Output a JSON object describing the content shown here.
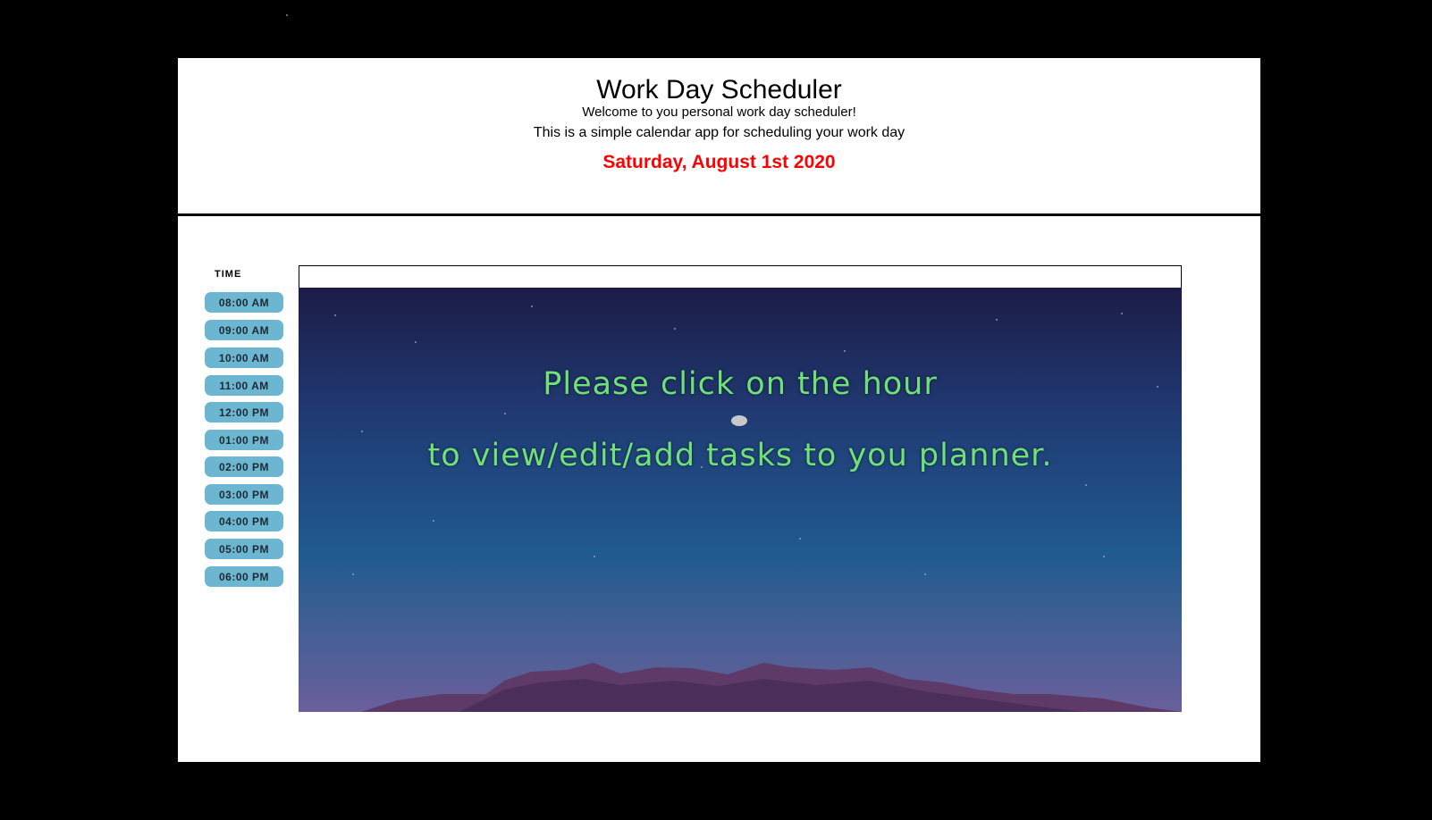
{
  "header": {
    "title": "Work Day Scheduler",
    "welcome": "Welcome to you personal work day scheduler!",
    "description": "This is a simple calendar app for scheduling your work day",
    "date": "Saturday, August 1st 2020",
    "date_color": "#ff0000"
  },
  "time_column": {
    "header": "TIME",
    "hours": [
      "08:00 AM",
      "09:00 AM",
      "10:00 AM",
      "11:00 AM",
      "12:00 PM",
      "01:00 PM",
      "02:00 PM",
      "03:00 PM",
      "04:00 PM",
      "05:00 PM",
      "06:00 PM"
    ],
    "button_color": "#6cb6d2"
  },
  "panel": {
    "message_line1": "Please click on the hour",
    "message_line2": "to view/edit/add tasks to you planner.",
    "text_color": "#6fe07a"
  }
}
